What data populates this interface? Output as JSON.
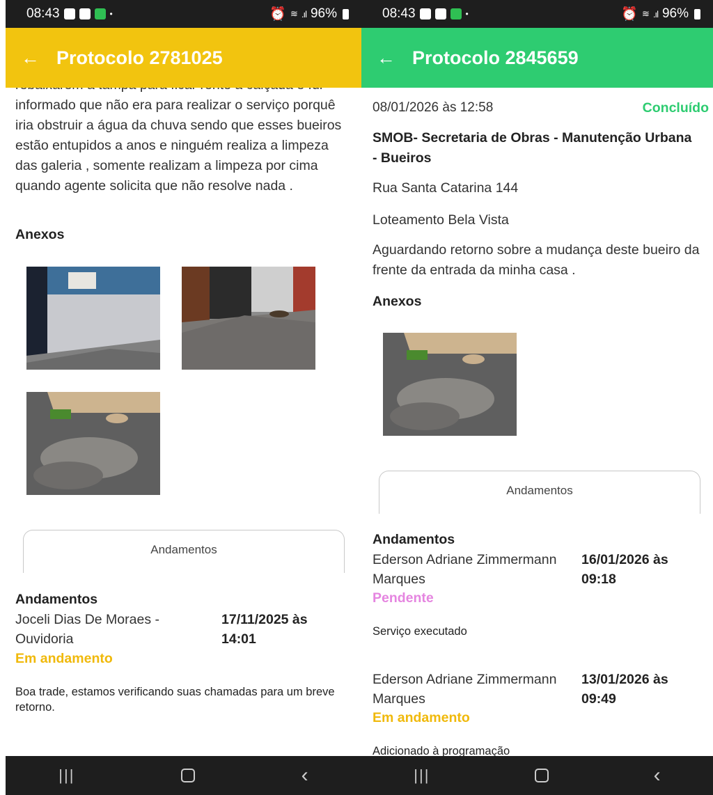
{
  "status_bar": {
    "time": "08:43",
    "battery": "96%"
  },
  "colors": {
    "left_accent": "#f2c40f",
    "right_accent": "#2ecc71",
    "pending": "#e585e0",
    "in_progress": "#f0b90b",
    "done": "#2ecc71"
  },
  "left": {
    "title": "Protocolo 2781025",
    "description": "rebaixarem a tampa para ficar rente à calçada e fui informado que não era para realizar o serviço porquê iria obstruir a água da chuva sendo que esses bueiros estão entupidos a anos e ninguém realiza a limpeza das galeria , somente realizam a limpeza por cima quando agente solicita que não resolve nada .",
    "attachments_heading": "Anexos",
    "andamentos_button": "Andamentos",
    "andamentos_heading": "Andamentos",
    "entries": [
      {
        "name": "Joceli Dias De Moraes - Ouvidoria",
        "date": "17/11/2025 às 14:01",
        "status": "Em andamento",
        "note": "Boa trade, estamos verificando suas chamadas para um breve retorno."
      }
    ]
  },
  "right": {
    "title": "Protocolo 2845659",
    "datetime": "08/01/2026 às 12:58",
    "status": "Concluído",
    "department": "SMOB- Secretaria de Obras - Manutenção Urbana - Bueiros",
    "address": "Rua Santa Catarina 144",
    "neighborhood": "Loteamento Bela Vista",
    "description": "Aguardando retorno sobre a mudança deste bueiro da frente da entrada da minha casa .",
    "attachments_heading": "Anexos",
    "andamentos_button": "Andamentos",
    "andamentos_heading": "Andamentos",
    "entries": [
      {
        "name": "Ederson Adriane Zimmermann Marques",
        "date": "16/01/2026 às 09:18",
        "status": "Pendente",
        "note": "Serviço executado"
      },
      {
        "name": "Ederson Adriane Zimmermann Marques",
        "date": "13/01/2026 às 09:49",
        "status": "Em andamento",
        "note": "Adicionado à programação"
      }
    ]
  },
  "nav": {
    "recent": "|||",
    "back": "<"
  }
}
